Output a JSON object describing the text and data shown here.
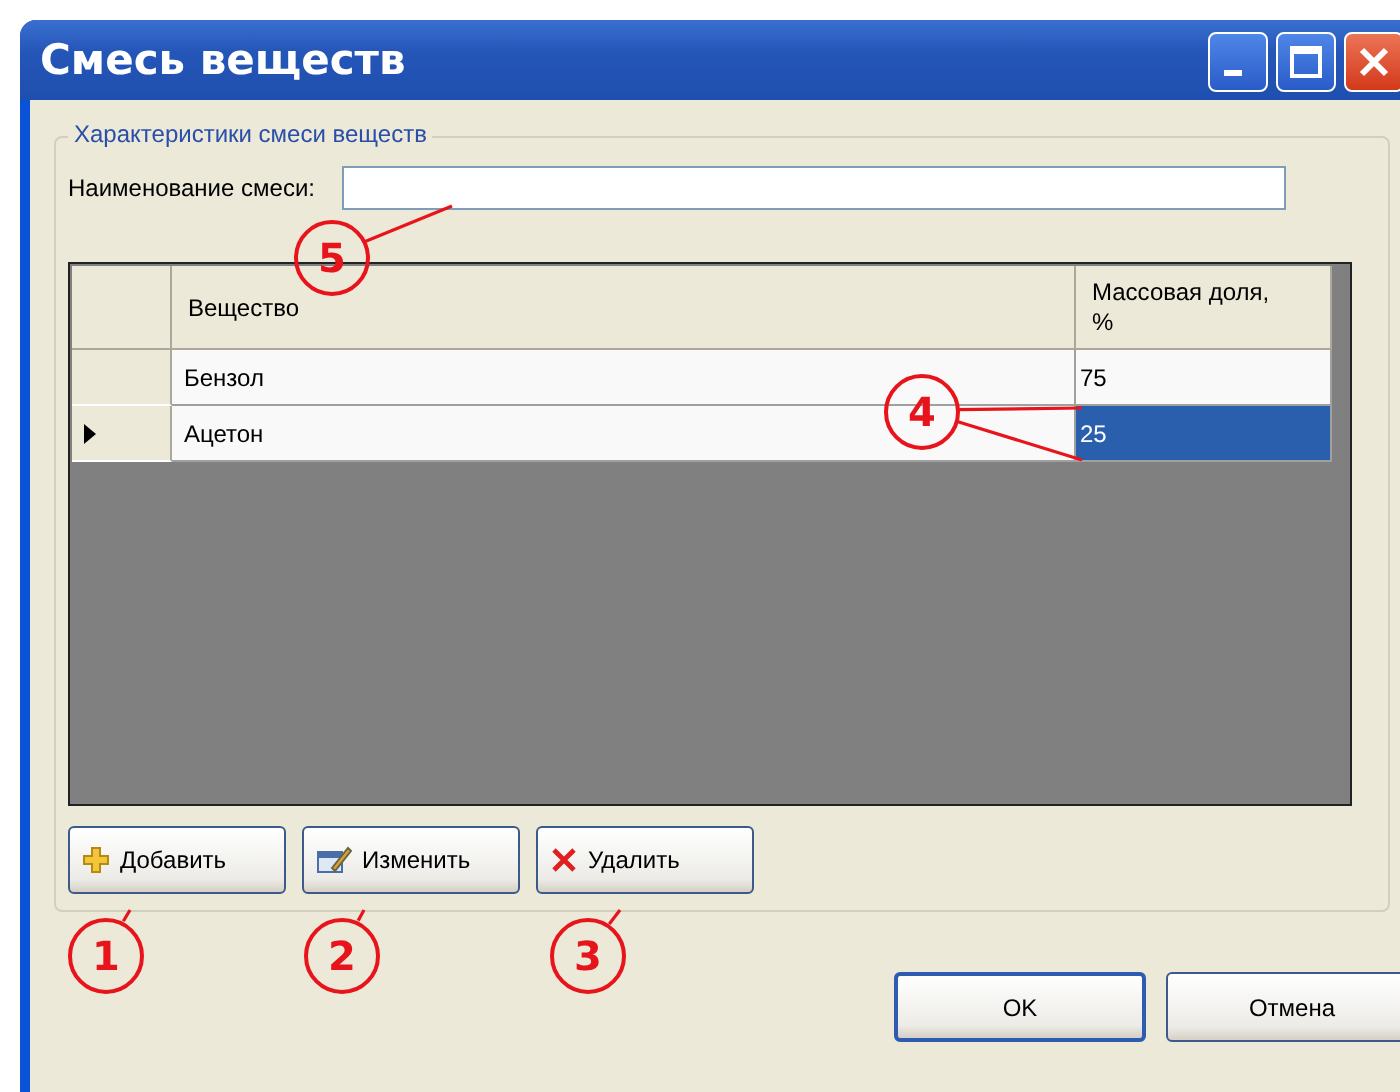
{
  "window": {
    "title": "Смесь веществ"
  },
  "group": {
    "legend": "Характеристики смеси веществ",
    "name_label": "Наименование смеси:"
  },
  "table": {
    "columns": [
      "Вещество",
      "Массовая доля, %"
    ],
    "rows": [
      {
        "current": false,
        "cells": [
          {
            "text": "Бензол",
            "selected": false
          },
          {
            "text": "75",
            "selected": false
          }
        ]
      },
      {
        "current": true,
        "cells": [
          {
            "text": "Ацетон",
            "selected": false
          },
          {
            "text": "25",
            "selected": true
          }
        ]
      }
    ]
  },
  "buttons": [
    {
      "kind": "add",
      "label": "Добавить"
    },
    {
      "kind": "edit",
      "label": "Изменить"
    },
    {
      "kind": "delete",
      "label": "Удалить"
    }
  ],
  "dialog_buttons": [
    {
      "label": "OK",
      "default": true
    },
    {
      "label": "Отмена",
      "default": false
    }
  ],
  "annotations": [
    {
      "label": "5"
    },
    {
      "label": "4"
    },
    {
      "label": "1"
    },
    {
      "label": "2"
    },
    {
      "label": "3"
    }
  ]
}
